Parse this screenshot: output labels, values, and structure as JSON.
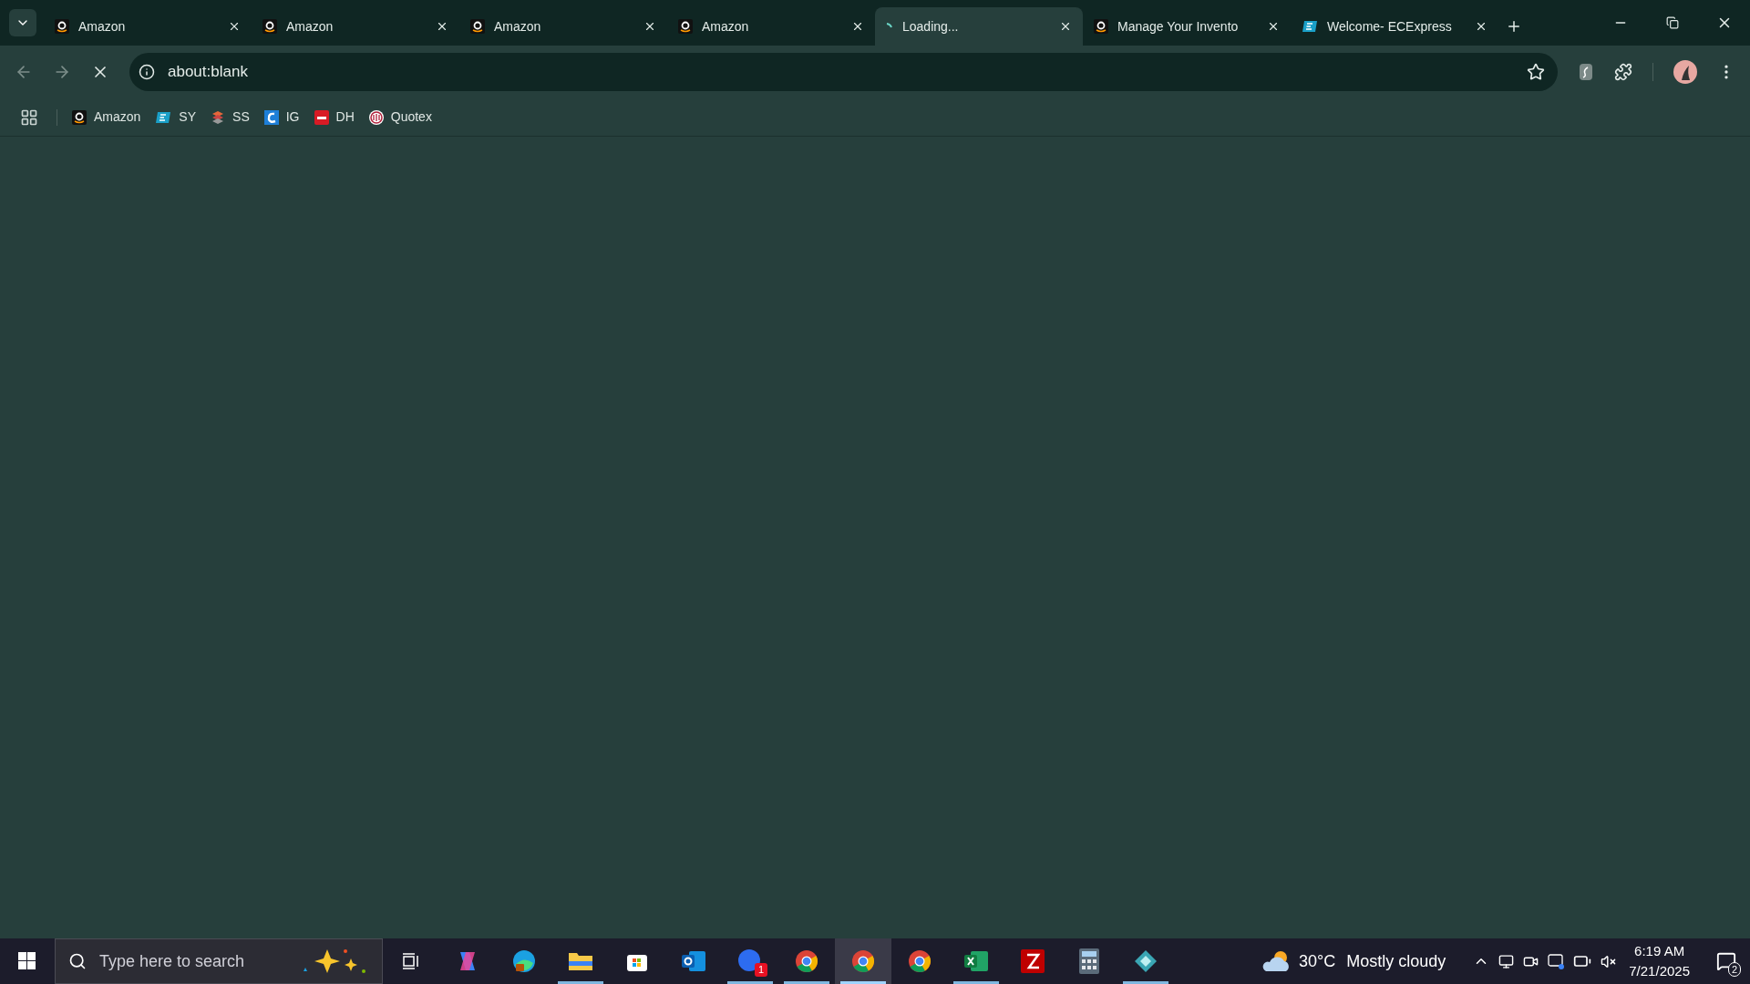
{
  "tabs": [
    {
      "kind": "amazon",
      "title": "Amazon",
      "selected": false
    },
    {
      "kind": "amazon",
      "title": "Amazon",
      "selected": false
    },
    {
      "kind": "amazon",
      "title": "Amazon",
      "selected": false
    },
    {
      "kind": "amazon",
      "title": "Amazon",
      "selected": false
    },
    {
      "kind": "loading",
      "title": "Loading...",
      "selected": true
    },
    {
      "kind": "amazon",
      "title": "Manage Your Invento",
      "selected": false
    },
    {
      "kind": "ec",
      "title": "Welcome- ECExpress",
      "selected": false
    }
  ],
  "address": {
    "value": "about:blank"
  },
  "bookmarks": [
    {
      "kind": "amazon",
      "label": "Amazon"
    },
    {
      "kind": "ec",
      "label": "SY"
    },
    {
      "kind": "ss",
      "label": "SS"
    },
    {
      "kind": "ig",
      "label": "IG"
    },
    {
      "kind": "dh",
      "label": "DH"
    },
    {
      "kind": "quotex",
      "label": "Quotex"
    }
  ],
  "taskbar": {
    "search_placeholder": "Type here to search",
    "apps": [
      {
        "kind": "taskview",
        "running": false,
        "selected": false
      },
      {
        "kind": "copilot",
        "running": false,
        "selected": false
      },
      {
        "kind": "edge",
        "running": false,
        "selected": false
      },
      {
        "kind": "folder",
        "running": true,
        "selected": false
      },
      {
        "kind": "store",
        "running": false,
        "selected": false
      },
      {
        "kind": "outlook",
        "running": false,
        "selected": false
      },
      {
        "kind": "zoom",
        "running": true,
        "selected": false,
        "badge": "1"
      },
      {
        "kind": "chrome",
        "running": true,
        "selected": false
      },
      {
        "kind": "chrome",
        "running": true,
        "selected": true
      },
      {
        "kind": "chrome",
        "running": false,
        "selected": false
      },
      {
        "kind": "excel",
        "running": true,
        "selected": false
      },
      {
        "kind": "filezilla",
        "running": false,
        "selected": false
      },
      {
        "kind": "calculator",
        "running": false,
        "selected": false
      },
      {
        "kind": "diamond",
        "running": true,
        "selected": false
      }
    ],
    "weather": {
      "temperature": "30°C",
      "condition": "Mostly cloudy"
    },
    "time": "6:19 AM",
    "date": "7/21/2025",
    "notifications": "2"
  }
}
